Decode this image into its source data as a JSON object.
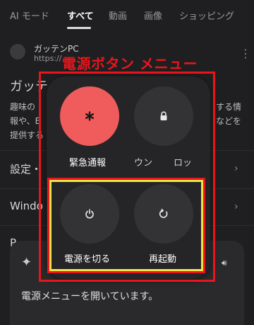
{
  "tabs": [
    {
      "label": "AI モード"
    },
    {
      "label": "すべて"
    },
    {
      "label": "動画"
    },
    {
      "label": "画像"
    },
    {
      "label": "ショッピング"
    }
  ],
  "result": {
    "site_name": "ガッテンPC",
    "url": "https://",
    "title": "ガッテ",
    "snippet_lines": [
      "趣味の",
      "報や、E",
      "提供する"
    ],
    "snippet_right": [
      "する情",
      "などを"
    ]
  },
  "list_items": [
    "設定・",
    "Windo",
    "P"
  ],
  "power_menu": {
    "annotation_title": "電源ボタン メニュー",
    "emergency_label": "緊急通報",
    "lockdown_label_left": "ウン",
    "lockdown_label_right": "ロッ",
    "power_off_label": "電源を切る",
    "restart_label": "再起動"
  },
  "assistant": {
    "message": "電源メニューを開いています。"
  },
  "colors": {
    "annotation_red": "#e8161c",
    "annotation_yellow": "#f4e24a",
    "emergency": "#f05b5b"
  }
}
